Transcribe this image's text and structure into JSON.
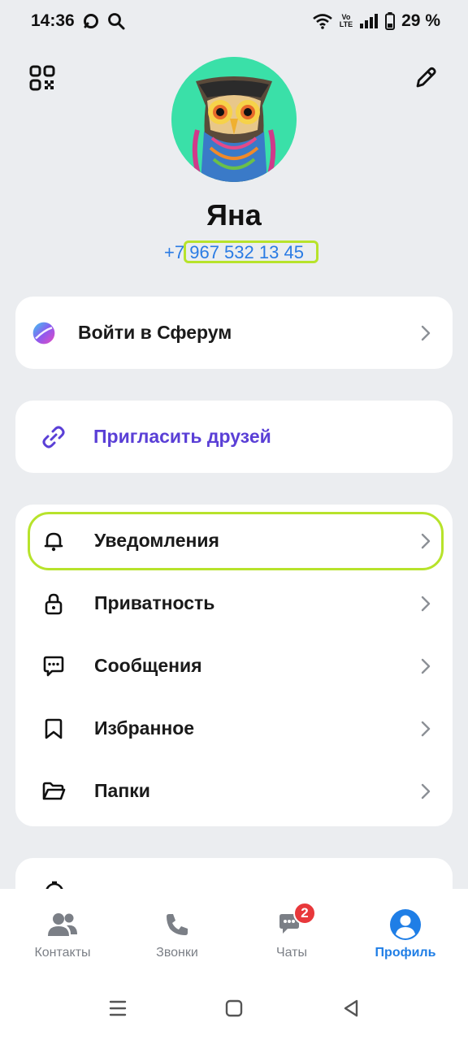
{
  "status": {
    "time": "14:36",
    "battery": "29 %",
    "network_label_top": "Vo",
    "network_label_bottom": "LTE"
  },
  "header": {
    "qr_icon": "qr-code-icon",
    "edit_icon": "pencil-icon"
  },
  "profile": {
    "name": "Яна",
    "phone": "+7 967 532 13 45"
  },
  "sferum": {
    "label": "Войти в Сферум"
  },
  "invite": {
    "label": "Пригласить друзей"
  },
  "settings": {
    "items": [
      {
        "label": "Уведомления",
        "icon": "bell-icon"
      },
      {
        "label": "Приватность",
        "icon": "lock-icon"
      },
      {
        "label": "Сообщения",
        "icon": "message-icon"
      },
      {
        "label": "Избранное",
        "icon": "bookmark-icon"
      },
      {
        "label": "Папки",
        "icon": "folder-icon"
      }
    ]
  },
  "tabs": [
    {
      "label": "Контакты",
      "icon": "contacts-icon"
    },
    {
      "label": "Звонки",
      "icon": "phone-icon"
    },
    {
      "label": "Чаты",
      "icon": "chats-icon",
      "badge": "2"
    },
    {
      "label": "Профиль",
      "icon": "profile-icon",
      "active": true
    }
  ],
  "colors": {
    "accent": "#1f7ee6",
    "link": "#2a7be4",
    "invite": "#5a3fd6",
    "highlight": "#b7e32b",
    "badge": "#e8383b"
  }
}
